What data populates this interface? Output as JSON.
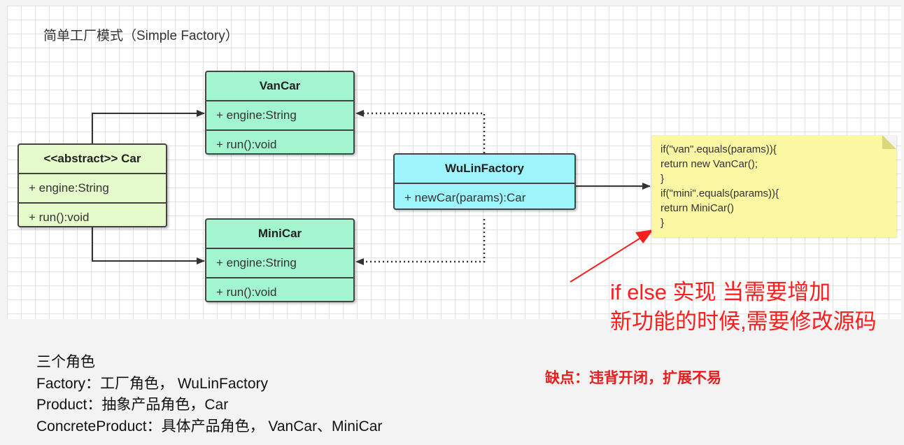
{
  "diagram_title": "简单工厂模式（Simple Factory）",
  "classes": {
    "vancar": {
      "name": "VanCar",
      "attr": "+ engine:String",
      "method": "+ run():void"
    },
    "car": {
      "name": "<<abstract>> Car",
      "attr": "+ engine:String",
      "method": "+ run():void"
    },
    "minicar": {
      "name": "MiniCar",
      "attr": "+ engine:String",
      "method": "+ run():void"
    },
    "factory": {
      "name": "WuLinFactory",
      "method": "+ newCar(params):Car"
    }
  },
  "note_lines": [
    "if(\"van\".equals(params)){",
    "return new VanCar();",
    "}",
    "if(\"mini\".equals(params)){",
    "return MiniCar()",
    "}"
  ],
  "annotation": {
    "line1": "if else 实现 当需要增加",
    "line2": "新功能的时候,需要修改源码"
  },
  "roles": {
    "heading": "三个角色",
    "factory": "Factory：工厂角色， WuLinFactory",
    "product": "Product：抽象产品角色，Car",
    "concrete": "ConcreteProduct：具体产品角色， VanCar、MiniCar"
  },
  "cons": "缺点：违背开闭，扩展不易",
  "colors": {
    "product_fill": "#a3f5cf",
    "abstract_fill": "#e6fbcb",
    "factory_fill": "#9ef4fb",
    "note_fill": "#fbf7a2",
    "annotation_red": "#ff1e1e"
  }
}
